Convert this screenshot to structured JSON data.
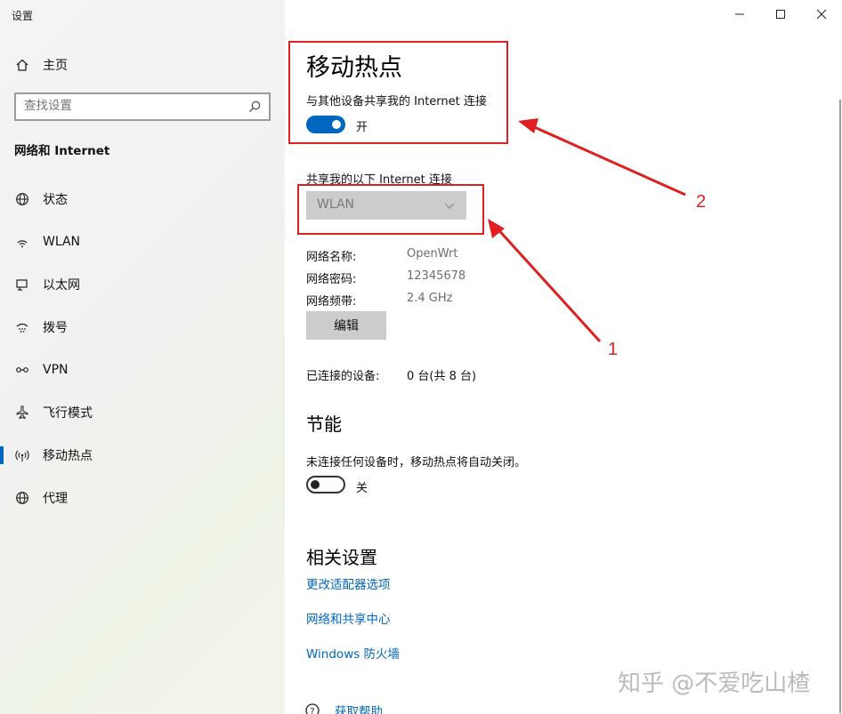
{
  "window": {
    "title": "设置",
    "minimize_glyph": "—",
    "maximize_glyph": "☐",
    "close_glyph": "✕"
  },
  "sidebar": {
    "home_label": "主页",
    "search_placeholder": "查找设置",
    "section_title": "网络和 Internet",
    "items": [
      {
        "label": "状态",
        "icon": "globe-icon"
      },
      {
        "label": "WLAN",
        "icon": "wifi-icon"
      },
      {
        "label": "以太网",
        "icon": "ethernet-icon"
      },
      {
        "label": "拨号",
        "icon": "dialup-icon"
      },
      {
        "label": "VPN",
        "icon": "vpn-icon"
      },
      {
        "label": "飞行模式",
        "icon": "airplane-icon"
      },
      {
        "label": "移动热点",
        "icon": "hotspot-icon",
        "active": true
      },
      {
        "label": "代理",
        "icon": "globe-icon"
      }
    ]
  },
  "main": {
    "title": "移动热点",
    "share_label": "与其他设备共享我的 Internet 连接",
    "share_toggle_state": "开",
    "share_from_label": "共享我的以下 Internet 连接",
    "share_from_value": "WLAN",
    "network_name_label": "网络名称:",
    "network_name_value": "OpenWrt",
    "network_password_label": "网络密码:",
    "network_password_value": "12345678",
    "network_band_label": "网络频带:",
    "network_band_value": "2.4 GHz",
    "edit_button": "编辑",
    "connected_label": "已连接的设备:",
    "connected_value": "0 台(共 8 台)",
    "power_saving_title": "节能",
    "power_saving_desc": "未连接任何设备时，移动热点将自动关闭。",
    "power_saving_toggle_state": "关",
    "related_title": "相关设置",
    "links": [
      "更改适配器选项",
      "网络和共享中心",
      "Windows 防火墙"
    ],
    "help_link": "获取帮助"
  },
  "annotations": {
    "label_1": "1",
    "label_2": "2",
    "color": "#e02020"
  },
  "watermark": "知乎 @不爱吃山楂",
  "colors": {
    "accent": "#0067c0",
    "dropdown_bg": "#cccccc"
  }
}
